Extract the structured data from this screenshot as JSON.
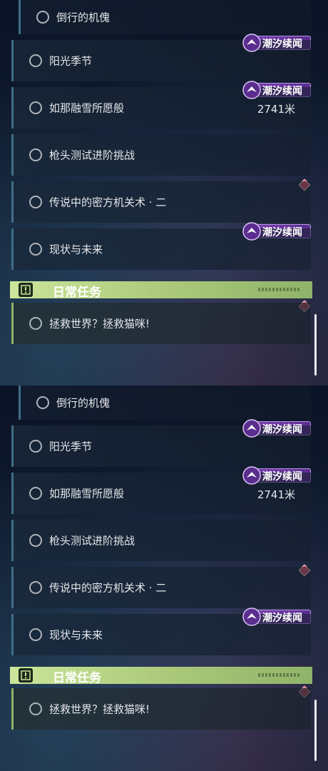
{
  "quests": [
    {
      "title": "倒行的机傀",
      "tag": null,
      "distance": null
    },
    {
      "title": "阳光季节",
      "tag": "潮汐续闻",
      "distance": null
    },
    {
      "title": "如那融雪所愿般",
      "tag": "潮汐续闻",
      "distance": "2741米"
    },
    {
      "title": "枪头测试进阶挑战",
      "tag": null,
      "distance": null
    },
    {
      "title": "传说中的密方机关术 · 二",
      "tag": null,
      "distance": null
    },
    {
      "title": "现状与未来",
      "tag": "潮汐续闻",
      "distance": null
    }
  ],
  "daily": {
    "header": "日常任务",
    "quest": "拯救世界？拯救猫咪!"
  },
  "colors": {
    "tag_purple": "#7a3fb0",
    "daily_green": "#a9c878",
    "alert_red": "#d8566a"
  },
  "icons": {
    "tag": "star-bird-icon",
    "daily": "exclamation-box-icon",
    "alert": "diamond-alert-icon"
  }
}
